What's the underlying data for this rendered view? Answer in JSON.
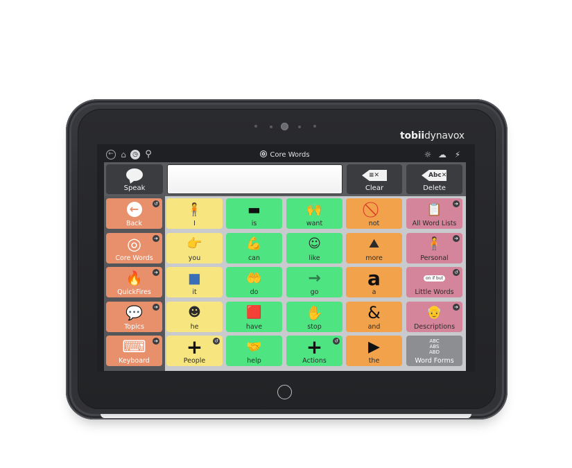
{
  "device": {
    "brand_bold": "tobii",
    "brand_light": "dynavox"
  },
  "toolbar": {
    "title": "Core Words",
    "icons": [
      "back-icon",
      "home-icon",
      "clock-icon",
      "search-icon",
      "bulb-icon",
      "cloud-icon",
      "wand-icon"
    ]
  },
  "top_row": {
    "speak_label": "Speak",
    "message_text": "",
    "clear_label": "Clear",
    "clear_icon_text": "≡✕",
    "delete_label": "Delete",
    "delete_icon_text": "Abc✕"
  },
  "grid": {
    "rows": [
      [
        {
          "label": "Back",
          "color": "orange",
          "symbol": "back-arrow",
          "glyph": "←",
          "badge": "back"
        },
        {
          "label": "I",
          "color": "yellow",
          "symbol": "person-self",
          "glyph": "🧍"
        },
        {
          "label": "is",
          "color": "green",
          "symbol": "dash",
          "glyph": "▬"
        },
        {
          "label": "want",
          "color": "green",
          "symbol": "hands-want",
          "glyph": "🙌"
        },
        {
          "label": "not",
          "color": "amber",
          "symbol": "no-sign",
          "glyph": "⃠"
        },
        {
          "label": "All Word Lists",
          "color": "pink",
          "symbol": "notepad",
          "glyph": "📋",
          "badge": "link"
        }
      ],
      [
        {
          "label": "Core Words",
          "color": "orange",
          "symbol": "target",
          "glyph": "◎",
          "badge": "link"
        },
        {
          "label": "you",
          "color": "yellow",
          "symbol": "person-pointing",
          "glyph": "👉"
        },
        {
          "label": "can",
          "color": "green",
          "symbol": "strong-arm",
          "glyph": "💪"
        },
        {
          "label": "like",
          "color": "green",
          "symbol": "smiling-face",
          "glyph": "☺"
        },
        {
          "label": "more",
          "color": "amber",
          "symbol": "pile",
          "glyph": "⛰"
        },
        {
          "label": "Personal",
          "color": "pink",
          "symbol": "person",
          "glyph": "🧍",
          "badge": "link"
        }
      ],
      [
        {
          "label": "QuickFires",
          "color": "orange",
          "symbol": "flame",
          "glyph": "🔥",
          "badge": "link"
        },
        {
          "label": "it",
          "color": "yellow",
          "symbol": "blue-square",
          "glyph": "■"
        },
        {
          "label": "do",
          "color": "green",
          "symbol": "hands-doing",
          "glyph": "🤲"
        },
        {
          "label": "go",
          "color": "green",
          "symbol": "right-arrow",
          "glyph": "→"
        },
        {
          "label": "a",
          "color": "amber",
          "symbol": "letter-a",
          "glyph": "a"
        },
        {
          "label": "Little Words",
          "color": "pink",
          "symbol": "word-bubbles",
          "glyph": "on if but",
          "badge": "back"
        }
      ],
      [
        {
          "label": "Topics",
          "color": "orange",
          "symbol": "speech-bubble",
          "glyph": "💬",
          "badge": "link"
        },
        {
          "label": "he",
          "color": "yellow",
          "symbol": "boy-face",
          "glyph": "☻"
        },
        {
          "label": "have",
          "color": "green",
          "symbol": "hand-holding",
          "glyph": "🟥"
        },
        {
          "label": "stop",
          "color": "green",
          "symbol": "red-hand",
          "glyph": "✋"
        },
        {
          "label": "and",
          "color": "amber",
          "symbol": "ampersand",
          "glyph": "&"
        },
        {
          "label": "Descriptions",
          "color": "pink",
          "symbol": "descriptions",
          "glyph": "👴",
          "badge": "link"
        }
      ],
      [
        {
          "label": "Keyboard",
          "color": "orange",
          "symbol": "keyboard",
          "glyph": "⌨",
          "badge": "link"
        },
        {
          "label": "People",
          "color": "yellow",
          "symbol": "plus",
          "glyph": "+",
          "badge": "back"
        },
        {
          "label": "help",
          "color": "green",
          "symbol": "helping-people",
          "glyph": "🤝"
        },
        {
          "label": "Actions",
          "color": "green",
          "symbol": "plus",
          "glyph": "+",
          "badge": "back"
        },
        {
          "label": "the",
          "color": "amber",
          "symbol": "play-triangle",
          "glyph": "▶"
        },
        {
          "label": "Word Forms",
          "color": "gray",
          "symbol": "abc-forms",
          "glyph": "ABC\nABS\nABD"
        }
      ]
    ]
  },
  "colors": {
    "orange": "#e8906c",
    "yellow": "#f7e67f",
    "green": "#4fe482",
    "amber": "#f2a24a",
    "pink": "#d4849b",
    "gray": "#8d8e91"
  }
}
